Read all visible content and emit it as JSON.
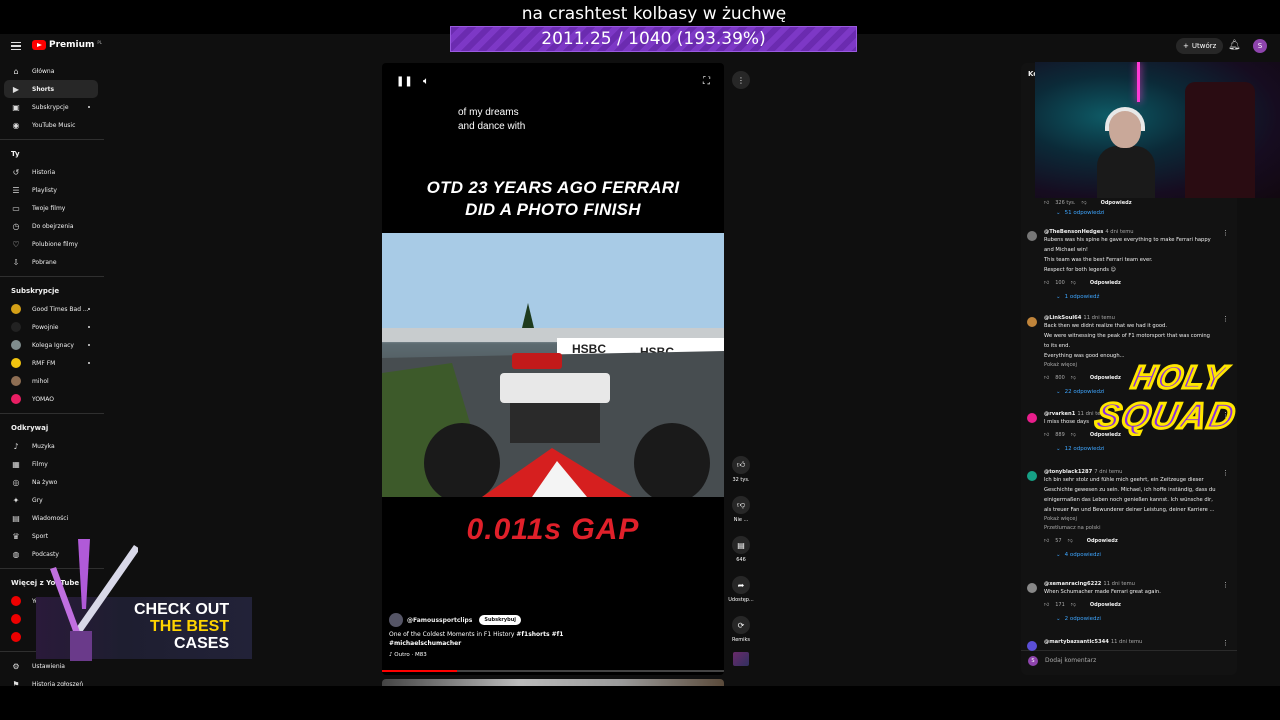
{
  "stream": {
    "title": "na crashtest kolbasy w żuchwę",
    "goal": "2011.25 / 1040 (193.39%)"
  },
  "header": {
    "logo_text": "Premium",
    "logo_sup": "PL",
    "create_label": "Utwórz",
    "avatar_letter": "S"
  },
  "sidebar": {
    "main": [
      {
        "label": "Główna",
        "icon": "home-icon"
      },
      {
        "label": "Shorts",
        "icon": "shorts-icon",
        "active": true
      },
      {
        "label": "Subskrypcje",
        "icon": "subscriptions-icon"
      },
      {
        "label": "YouTube Music",
        "icon": "music-icon"
      }
    ],
    "you_heading": "Ty",
    "you": [
      {
        "label": "Historia",
        "icon": "history-icon"
      },
      {
        "label": "Playlisty",
        "icon": "playlist-icon"
      },
      {
        "label": "Twoje filmy",
        "icon": "video-icon"
      },
      {
        "label": "Do obejrzenia",
        "icon": "clock-icon"
      },
      {
        "label": "Polubione filmy",
        "icon": "like-icon"
      },
      {
        "label": "Pobrane",
        "icon": "download-icon"
      }
    ],
    "subs_heading": "Subskrypcje",
    "subs": [
      {
        "label": "Good Times Bad ...",
        "color": "#d4a017"
      },
      {
        "label": "Powojnie",
        "color": "#222222"
      },
      {
        "label": "Kolega Ignacy",
        "color": "#7f8c8d"
      },
      {
        "label": "RMF FM",
        "color": "#f1c40f"
      },
      {
        "label": "mihol",
        "color": "#8e6e53"
      },
      {
        "label": "YOMAO",
        "color": "#e91e63"
      }
    ],
    "explore_heading": "Odkrywaj",
    "explore": [
      {
        "label": "Muzyka",
        "icon": "music-note-icon"
      },
      {
        "label": "Filmy",
        "icon": "film-icon"
      },
      {
        "label": "Na żywo",
        "icon": "live-icon"
      },
      {
        "label": "Gry",
        "icon": "gamepad-icon"
      },
      {
        "label": "Wiadomości",
        "icon": "news-icon"
      },
      {
        "label": "Sport",
        "icon": "trophy-icon"
      },
      {
        "label": "Podcasty",
        "icon": "podcast-icon"
      }
    ],
    "more_heading": "Więcej z YouTube",
    "more_item": "YouTube Studio",
    "settings": "Ustawienia",
    "report_history": "Historia zgłoszeń"
  },
  "promo": {
    "line1": "CHECK OUT",
    "line2": "THE BEST",
    "line3": "CASES"
  },
  "short": {
    "caption": "of my dreams\nand dance with",
    "headline_1": "OTD 23 YEARS AGO FERRARI",
    "headline_2": "DID A PHOTO FINISH",
    "gap": "0.011s GAP",
    "channel": "@Famoussportclips",
    "subscribe": "Subskrybuj",
    "description": "One of the Coldest Moments in F1 History",
    "hashtags": "#f1shorts #f1 #michaelschumacher",
    "music": "Outro · M83",
    "sign_text": "HSBC"
  },
  "actions": {
    "likes": "32 tys.",
    "dislike": "Nie ...",
    "comments": "646",
    "share": "Udostęp...",
    "remix": "Remiks"
  },
  "comments": {
    "heading": "Ko",
    "top_likes": "326 tys.",
    "top_replies": "51 odpowiedzi",
    "reply_label": "Odpowiedz",
    "show_more": "Pokaż więcej",
    "translate": "Przetłumacz na polski",
    "add_placeholder": "Dodaj komentarz",
    "add_avatar": "S",
    "items": [
      {
        "user": "@TheBensonHedges",
        "time": "4 dni temu",
        "color": "#777777",
        "lines": [
          "Rubens was his spine he gave everything to make Ferrari happy",
          "and Michael win!",
          "This team was the best Ferrari team ever.",
          "Respect for both legends 😊"
        ],
        "likes": "100",
        "replies": "1 odpowiedź"
      },
      {
        "user": "@LinkSoul64",
        "time": "11 dni temu",
        "color": "#c0843a",
        "lines": [
          "Back then we didnt realize that we had it good.",
          "We were witnessing the peak of F1 motorsport that was coming",
          "to its end.",
          "Everything was good enough..."
        ],
        "likes": "800",
        "replies": "22 odpowiedzi"
      },
      {
        "user": "@rvarken1",
        "time": "11 dni temu",
        "color": "#e91e8c",
        "lines": [
          "I miss those days"
        ],
        "likes": "889",
        "replies": "12 odpowiedzi"
      },
      {
        "user": "@tonyblack1287",
        "time": "7 dni temu",
        "color": "#16a085",
        "lines": [
          "Ich bin sehr stolz und fühle mich geehrt, ein Zeitzeuge dieser",
          "Geschichte gewesen zu sein. Michael, ich hoffe inständig, dass du",
          "einigermaßen das Leben noch genießen kannst. Ich wünsche dir,",
          "als treuer Fan und Bewunderer deiner Leistung, deiner Karriere ..."
        ],
        "likes": "57",
        "replies": "4 odpowiedzi"
      },
      {
        "user": "@xemanracing6222",
        "time": "11 dni temu",
        "color": "#888888",
        "lines": [
          "When Schumacher made Ferrari great again."
        ],
        "likes": "171",
        "replies": "2 odpowiedzi"
      },
      {
        "user": "@martybazsantic5344",
        "time": "11 dni temu",
        "color": "#5b4fd6",
        "lines": [],
        "likes": "",
        "replies": ""
      }
    ]
  },
  "overlay": {
    "holy_1": "HOLY",
    "holy_2": "SQUAD"
  }
}
